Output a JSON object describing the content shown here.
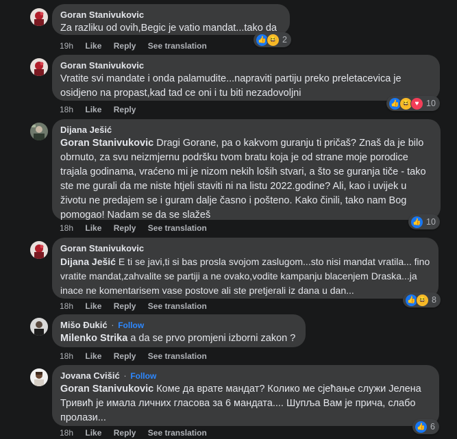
{
  "actions": {
    "like": "Like",
    "reply": "Reply",
    "see_translation": "See translation",
    "follow": "Follow"
  },
  "comments": [
    {
      "author": "Goran Stanivukovic",
      "text": "Za razliku od ovih,Begic je vatio mandat...tako da",
      "time": "19h",
      "reactions": [
        "like-icon",
        "haha-icon"
      ],
      "reaction_count": "2"
    },
    {
      "author": "Goran Stanivukovic",
      "text": "Vratite svi mandate i onda palamudite...napraviti partiju preko preletacevica je osidjeno na propast,kad tad ce oni i tu biti nezadovoljni",
      "time": "18h",
      "reactions": [
        "like-icon",
        "haha-icon",
        "love-icon"
      ],
      "reaction_count": "10"
    },
    {
      "author": "Dijana Ješić",
      "mention": "Goran Stanivukovic",
      "text": "Dragi Gorane, pa o kakvom guranju ti pričaš? Znaš da je bilo obrnuto, za svu neizmjernu podršku tvom bratu koja je od strane moje porodice trajala godinama, vraćeno mi je nizom nekih loših stvari, a što se guranja tiče - tako ste me gurali da me niste htjeli staviti ni na listu 2022.godine? Ali, kao i uvijek u životu ne predajem se i guram dalje časno i pošteno. Kako činili, tako nam Bog pomogao! Nadam se da se slažeš",
      "time": "18h",
      "reactions": [
        "like-icon"
      ],
      "reaction_count": "10"
    },
    {
      "author": "Goran Stanivukovic",
      "mention": "Dijana Ješić",
      "text": "E ti se javi,ti si bas prosla svojom zaslugom...sto nisi mandat vratila... fino vratite mandat,zahvalite se partiji a ne ovako,vodite kampanju blacenjem Draska...ja inace ne komentarisem vase postove ali ste pretjerali iz dana u dan...",
      "time": "18h",
      "reactions": [
        "like-icon",
        "haha-icon"
      ],
      "reaction_count": "8"
    },
    {
      "author": "Mišo Đukić",
      "mention": "Milenko Strika",
      "text": "a da se prvo promjeni izborni zakon ?",
      "time": "18h",
      "reactions": [],
      "reaction_count": ""
    },
    {
      "author": "Jovana Cvišić",
      "mention": "Goran Stanivukovic",
      "text": "Коме да врате мандат? Колико ме сјећање служи Јелена Тривић је имала личних гласова за 6 мандата.... Шупља Вам је прича, слабо пролази...",
      "time": "18h",
      "reactions": [
        "like-icon"
      ],
      "reaction_count": "6"
    }
  ]
}
